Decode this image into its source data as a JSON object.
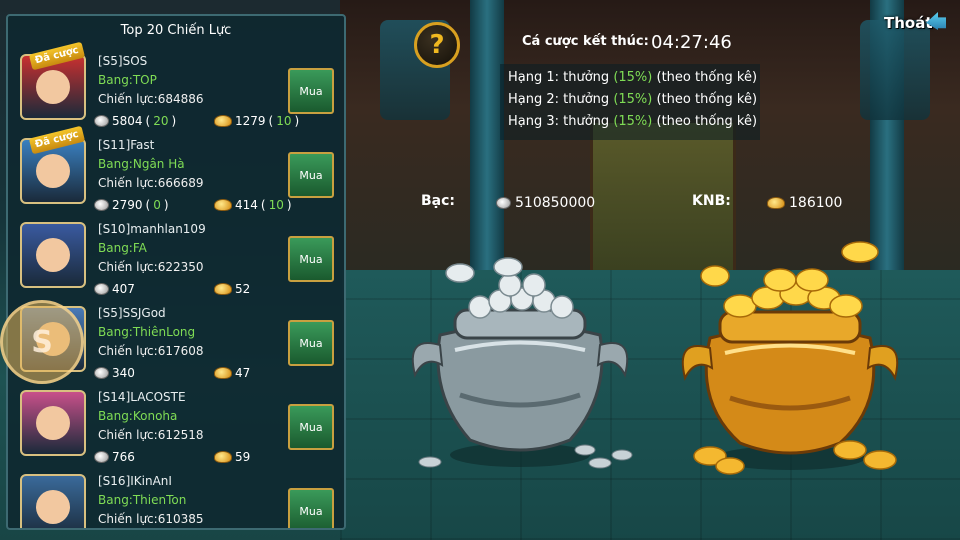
{
  "panel": {
    "title": "Top 20 Chiến Lực",
    "buy_label": "Mua",
    "players": [
      {
        "name": "[S5]SOS",
        "guild": "Bang:TOP",
        "power": "Chiến lực:684886",
        "silver": "5804",
        "silver_extra": "20",
        "gold": "1279",
        "gold_extra": "10",
        "badge": "Đã cược",
        "color": "#c83030"
      },
      {
        "name": "[S11]Fast",
        "guild": "Bang:Ngân Hà",
        "power": "Chiến lực:666689",
        "silver": "2790",
        "silver_extra": "0",
        "gold": "414",
        "gold_extra": "10",
        "badge": "Đã cược",
        "color": "#3a80c0"
      },
      {
        "name": "[S10]manhlan109",
        "guild": "Bang:FA",
        "power": "Chiến lực:622350",
        "silver": "407",
        "silver_extra": "",
        "gold": "52",
        "gold_extra": "",
        "badge": "",
        "color": "#3a5aa0"
      },
      {
        "name": "[S5]SSJGod",
        "guild": "Bang:ThiênLong",
        "power": "Chiến lực:617608",
        "silver": "340",
        "silver_extra": "",
        "gold": "47",
        "gold_extra": "",
        "badge": "",
        "color": "#4a7ab8"
      },
      {
        "name": "[S14]LACOSTE",
        "guild": "Bang:Konoha",
        "power": "Chiến lực:612518",
        "silver": "766",
        "silver_extra": "",
        "gold": "59",
        "gold_extra": "",
        "badge": "",
        "color": "#c8508a"
      },
      {
        "name": "[S16]IKinAnI",
        "guild": "Bang:ThienTon",
        "power": "Chiến lực:610385",
        "silver": "",
        "silver_extra": "",
        "gold": "",
        "gold_extra": "",
        "badge": "",
        "color": "#3a6a9a"
      }
    ]
  },
  "overlay_badge": "S",
  "help_icon": "?",
  "bet": {
    "label": "Cá cược kết thúc:",
    "time": "04:27:46"
  },
  "ranks": [
    {
      "prefix": "Hạng 1: thưởng ",
      "pct": "(15%)",
      "suffix": " (theo thống kê)"
    },
    {
      "prefix": "Hạng 2: thưởng ",
      "pct": "(15%)",
      "suffix": " (theo thống kê)"
    },
    {
      "prefix": "Hạng 3: thưởng ",
      "pct": "(15%)",
      "suffix": " (theo thống kê)"
    }
  ],
  "exit_label": "Thoát",
  "silver_pool": {
    "label": "Bạc:",
    "value": "510850000"
  },
  "gold_pool": {
    "label": "KNB:",
    "value": "186100"
  },
  "colors": {
    "accent_green": "#7fdc55",
    "gold": "#d8a020"
  }
}
